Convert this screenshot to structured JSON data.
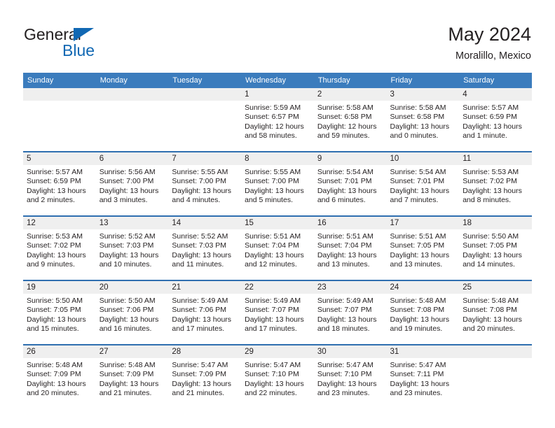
{
  "brand": {
    "name_top": "General",
    "name_bottom": "Blue",
    "triangle_icon": "blue-triangle-icon",
    "color_dark": "#231f20",
    "color_blue": "#1168b3"
  },
  "header": {
    "title": "May 2024",
    "subtitle": "Moralillo, Mexico"
  },
  "theme": {
    "header_blue": "#3b7cbd",
    "row_border_blue": "#2f6fb0",
    "daynum_band": "#efefef",
    "text": "#231f20"
  },
  "weekday_headers": [
    "Sunday",
    "Monday",
    "Tuesday",
    "Wednesday",
    "Thursday",
    "Friday",
    "Saturday"
  ],
  "weeks": [
    [
      {
        "day": "",
        "sunrise": "",
        "sunset": "",
        "daylight": "",
        "empty": true
      },
      {
        "day": "",
        "sunrise": "",
        "sunset": "",
        "daylight": "",
        "empty": true
      },
      {
        "day": "",
        "sunrise": "",
        "sunset": "",
        "daylight": "",
        "empty": true
      },
      {
        "day": "1",
        "sunrise": "Sunrise: 5:59 AM",
        "sunset": "Sunset: 6:57 PM",
        "daylight": "Daylight: 12 hours and 58 minutes."
      },
      {
        "day": "2",
        "sunrise": "Sunrise: 5:58 AM",
        "sunset": "Sunset: 6:58 PM",
        "daylight": "Daylight: 12 hours and 59 minutes."
      },
      {
        "day": "3",
        "sunrise": "Sunrise: 5:58 AM",
        "sunset": "Sunset: 6:58 PM",
        "daylight": "Daylight: 13 hours and 0 minutes."
      },
      {
        "day": "4",
        "sunrise": "Sunrise: 5:57 AM",
        "sunset": "Sunset: 6:59 PM",
        "daylight": "Daylight: 13 hours and 1 minute."
      }
    ],
    [
      {
        "day": "5",
        "sunrise": "Sunrise: 5:57 AM",
        "sunset": "Sunset: 6:59 PM",
        "daylight": "Daylight: 13 hours and 2 minutes."
      },
      {
        "day": "6",
        "sunrise": "Sunrise: 5:56 AM",
        "sunset": "Sunset: 7:00 PM",
        "daylight": "Daylight: 13 hours and 3 minutes."
      },
      {
        "day": "7",
        "sunrise": "Sunrise: 5:55 AM",
        "sunset": "Sunset: 7:00 PM",
        "daylight": "Daylight: 13 hours and 4 minutes."
      },
      {
        "day": "8",
        "sunrise": "Sunrise: 5:55 AM",
        "sunset": "Sunset: 7:00 PM",
        "daylight": "Daylight: 13 hours and 5 minutes."
      },
      {
        "day": "9",
        "sunrise": "Sunrise: 5:54 AM",
        "sunset": "Sunset: 7:01 PM",
        "daylight": "Daylight: 13 hours and 6 minutes."
      },
      {
        "day": "10",
        "sunrise": "Sunrise: 5:54 AM",
        "sunset": "Sunset: 7:01 PM",
        "daylight": "Daylight: 13 hours and 7 minutes."
      },
      {
        "day": "11",
        "sunrise": "Sunrise: 5:53 AM",
        "sunset": "Sunset: 7:02 PM",
        "daylight": "Daylight: 13 hours and 8 minutes."
      }
    ],
    [
      {
        "day": "12",
        "sunrise": "Sunrise: 5:53 AM",
        "sunset": "Sunset: 7:02 PM",
        "daylight": "Daylight: 13 hours and 9 minutes."
      },
      {
        "day": "13",
        "sunrise": "Sunrise: 5:52 AM",
        "sunset": "Sunset: 7:03 PM",
        "daylight": "Daylight: 13 hours and 10 minutes."
      },
      {
        "day": "14",
        "sunrise": "Sunrise: 5:52 AM",
        "sunset": "Sunset: 7:03 PM",
        "daylight": "Daylight: 13 hours and 11 minutes."
      },
      {
        "day": "15",
        "sunrise": "Sunrise: 5:51 AM",
        "sunset": "Sunset: 7:04 PM",
        "daylight": "Daylight: 13 hours and 12 minutes."
      },
      {
        "day": "16",
        "sunrise": "Sunrise: 5:51 AM",
        "sunset": "Sunset: 7:04 PM",
        "daylight": "Daylight: 13 hours and 13 minutes."
      },
      {
        "day": "17",
        "sunrise": "Sunrise: 5:51 AM",
        "sunset": "Sunset: 7:05 PM",
        "daylight": "Daylight: 13 hours and 13 minutes."
      },
      {
        "day": "18",
        "sunrise": "Sunrise: 5:50 AM",
        "sunset": "Sunset: 7:05 PM",
        "daylight": "Daylight: 13 hours and 14 minutes."
      }
    ],
    [
      {
        "day": "19",
        "sunrise": "Sunrise: 5:50 AM",
        "sunset": "Sunset: 7:05 PM",
        "daylight": "Daylight: 13 hours and 15 minutes."
      },
      {
        "day": "20",
        "sunrise": "Sunrise: 5:50 AM",
        "sunset": "Sunset: 7:06 PM",
        "daylight": "Daylight: 13 hours and 16 minutes."
      },
      {
        "day": "21",
        "sunrise": "Sunrise: 5:49 AM",
        "sunset": "Sunset: 7:06 PM",
        "daylight": "Daylight: 13 hours and 17 minutes."
      },
      {
        "day": "22",
        "sunrise": "Sunrise: 5:49 AM",
        "sunset": "Sunset: 7:07 PM",
        "daylight": "Daylight: 13 hours and 17 minutes."
      },
      {
        "day": "23",
        "sunrise": "Sunrise: 5:49 AM",
        "sunset": "Sunset: 7:07 PM",
        "daylight": "Daylight: 13 hours and 18 minutes."
      },
      {
        "day": "24",
        "sunrise": "Sunrise: 5:48 AM",
        "sunset": "Sunset: 7:08 PM",
        "daylight": "Daylight: 13 hours and 19 minutes."
      },
      {
        "day": "25",
        "sunrise": "Sunrise: 5:48 AM",
        "sunset": "Sunset: 7:08 PM",
        "daylight": "Daylight: 13 hours and 20 minutes."
      }
    ],
    [
      {
        "day": "26",
        "sunrise": "Sunrise: 5:48 AM",
        "sunset": "Sunset: 7:09 PM",
        "daylight": "Daylight: 13 hours and 20 minutes."
      },
      {
        "day": "27",
        "sunrise": "Sunrise: 5:48 AM",
        "sunset": "Sunset: 7:09 PM",
        "daylight": "Daylight: 13 hours and 21 minutes."
      },
      {
        "day": "28",
        "sunrise": "Sunrise: 5:47 AM",
        "sunset": "Sunset: 7:09 PM",
        "daylight": "Daylight: 13 hours and 21 minutes."
      },
      {
        "day": "29",
        "sunrise": "Sunrise: 5:47 AM",
        "sunset": "Sunset: 7:10 PM",
        "daylight": "Daylight: 13 hours and 22 minutes."
      },
      {
        "day": "30",
        "sunrise": "Sunrise: 5:47 AM",
        "sunset": "Sunset: 7:10 PM",
        "daylight": "Daylight: 13 hours and 23 minutes."
      },
      {
        "day": "31",
        "sunrise": "Sunrise: 5:47 AM",
        "sunset": "Sunset: 7:11 PM",
        "daylight": "Daylight: 13 hours and 23 minutes."
      },
      {
        "day": "",
        "sunrise": "",
        "sunset": "",
        "daylight": "",
        "empty": true
      }
    ]
  ]
}
